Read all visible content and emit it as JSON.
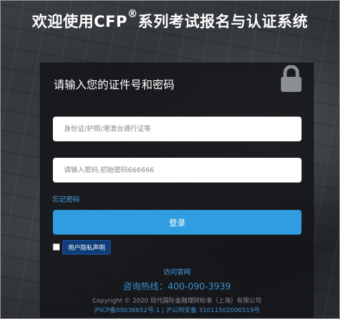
{
  "header": {
    "title_prefix": "欢迎使用CFP",
    "registered_mark": "®",
    "title_suffix": "系列考试报名与认证系统"
  },
  "login_panel": {
    "title": "请输入您的证件号和密码",
    "lock_icon": "lock-icon",
    "id_input": {
      "placeholder": "身份证/护照/港澳台通行证等",
      "value": ""
    },
    "password_input": {
      "placeholder": "请输入密码,初始密码666666",
      "value": ""
    },
    "forgot_link": "忘记密码",
    "login_button": "登录",
    "privacy_checkbox_checked": false,
    "privacy_button": "用户隐私声明"
  },
  "footer": {
    "visit_link": "访问官网",
    "hotline": "咨询热线：400-090-3939",
    "copyright": "Copyright © 2020 现代国际金融理财标准（上海）有限公司",
    "icp": "沪ICP备09036652号-1 | 沪公网安备 31011502006519号"
  },
  "colors": {
    "accent": "#2f9de0",
    "link": "#4aa3e8",
    "privacy_button": "#0e3d7a",
    "panel": "#121417"
  }
}
